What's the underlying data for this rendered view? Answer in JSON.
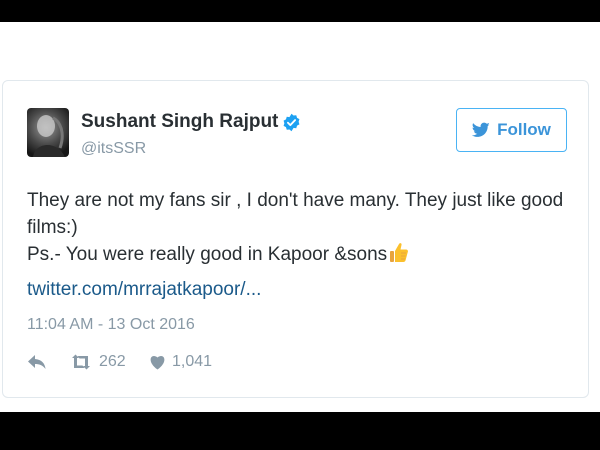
{
  "tweet": {
    "author_name": "Sushant Singh Rajput",
    "handle": "@itsSSR",
    "follow_label": "Follow",
    "text_lines": [
      "They are not my fans sir , I don't have many. They just like good",
      "films:)",
      "Ps.- You were really good in Kapoor &sons"
    ],
    "link_text": "twitter.com/mrrajatkapoor/...",
    "timestamp": "11:04 AM - 13 Oct 2016",
    "retweet_count": "262",
    "like_count": "1,041"
  },
  "icons": {
    "verified": "verified-badge-icon",
    "follow": "twitter-bird-icon",
    "emoji": "thumbs-up-emoji",
    "reply": "reply-icon",
    "retweet": "retweet-icon",
    "like": "heart-icon"
  },
  "colors": {
    "twitter_blue": "#3b94d9",
    "verified_blue": "#1da1f2",
    "text": "#292f33",
    "muted": "#8899a6",
    "link": "#1b5a8a",
    "letterbox": "#000000"
  }
}
